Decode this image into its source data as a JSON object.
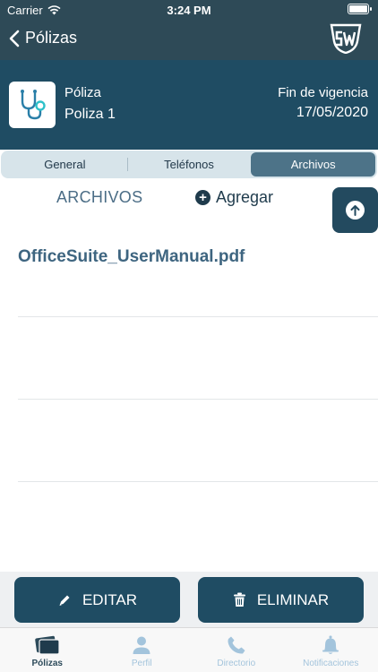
{
  "status_bar": {
    "carrier": "Carrier",
    "time": "3:24 PM"
  },
  "nav": {
    "back_label": "Pólizas",
    "logo_alt": "SW"
  },
  "policy": {
    "type": "Póliza",
    "name": "Poliza 1",
    "end_label": "Fin de vigencia",
    "end_date": "17/05/2020",
    "thumbnail_icon": "stethoscope-icon"
  },
  "segments": [
    {
      "label": "General",
      "active": false
    },
    {
      "label": "Teléfonos",
      "active": false
    },
    {
      "label": "Archivos",
      "active": true
    }
  ],
  "files": {
    "title": "ARCHIVOS",
    "add_label": "Agregar",
    "items": [
      {
        "name": "OfficeSuite_UserManual.pdf"
      },
      {
        "name": ""
      },
      {
        "name": ""
      }
    ]
  },
  "actions": {
    "edit_label": "EDITAR",
    "delete_label": "ELIMINAR"
  },
  "tabbar": [
    {
      "label": "Pólizas",
      "icon": "policies-icon",
      "active": true
    },
    {
      "label": "Perfil",
      "icon": "person-icon",
      "active": false
    },
    {
      "label": "Directorio",
      "icon": "phone-icon",
      "active": false
    },
    {
      "label": "Notificaciones",
      "icon": "bell-icon",
      "active": false
    }
  ],
  "colors": {
    "primary": "#1f4c63",
    "nav": "#2e4a57",
    "accent": "#4d7388",
    "inactive_tab": "#a3c4dc"
  }
}
